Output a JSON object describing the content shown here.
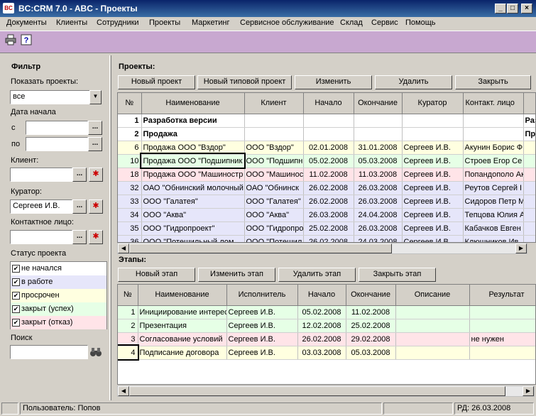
{
  "window": {
    "title": "BC:CRM 7.0 - ABC - Проекты",
    "logo_text": "BC"
  },
  "menu": [
    "Документы",
    "Клиенты",
    "Сотрудники",
    "Проекты",
    "Маркетинг",
    "Сервисное обслуживание",
    "Склад",
    "Сервис",
    "Помощь"
  ],
  "toolbar": {
    "icons": [
      "printer-icon",
      "help-icon"
    ]
  },
  "filter": {
    "title": "Фильтр",
    "show_projects_label": "Показать проекты:",
    "show_projects_value": "все",
    "start_date_label": "Дата начала",
    "from_label": "с",
    "to_label": "по",
    "client_label": "Клиент:",
    "client_value": "",
    "curator_label": "Куратор:",
    "curator_value": "Сергеев И.В.",
    "contact_label": "Контактное лицо:",
    "contact_value": "",
    "status_label": "Статус проекта",
    "statuses": [
      {
        "label": "не начался",
        "color": "#ffffff"
      },
      {
        "label": "в работе",
        "color": "#e6e6fa"
      },
      {
        "label": "просрочен",
        "color": "#ffffe0"
      },
      {
        "label": "закрыт (успех)",
        "color": "#e6ffe6"
      },
      {
        "label": "закрыт (отказ)",
        "color": "#ffe4e8"
      }
    ],
    "search_label": "Поиск",
    "search_value": "",
    "dots": "...",
    "dropdown_arrow": "▼"
  },
  "projects": {
    "title": "Проекты:",
    "buttons": [
      "Новый проект",
      "Новый типовой проект",
      "Изменить",
      "Удалить",
      "Закрыть"
    ],
    "columns": [
      "№",
      "Наименование",
      "Клиент",
      "Начало",
      "Окончание",
      "Куратор",
      "Контакт. лицо"
    ],
    "rows": [
      {
        "n": "1",
        "name": "Разработка версии",
        "client": "",
        "start": "",
        "end": "",
        "curator": "",
        "contact": "",
        "extra": "Раз",
        "bold": true,
        "color": "#ffffff"
      },
      {
        "n": "2",
        "name": "Продажа",
        "client": "",
        "start": "",
        "end": "",
        "curator": "",
        "contact": "",
        "extra": "Пр",
        "bold": true,
        "color": "#ffffff"
      },
      {
        "n": "6",
        "name": "Продажа ООО \"Вздор\"",
        "client": "ООО \"Вздор\"",
        "start": "02.01.2008",
        "end": "31.01.2008",
        "curator": "Сергеев И.В.",
        "contact": "Акунин Борис Ф",
        "extra": "",
        "bold": false,
        "color": "#ffffe0"
      },
      {
        "n": "10",
        "name": "Продажа ООО \"Подшипник",
        "client": "ООО \"Подшипн",
        "start": "05.02.2008",
        "end": "05.03.2008",
        "curator": "Сергеев И.В.",
        "contact": "Строев Егор Се",
        "extra": "",
        "bold": false,
        "color": "#e6ffe6",
        "selected": true
      },
      {
        "n": "18",
        "name": "Продажа ООО \"Машиностр",
        "client": "ООО \"Машиност",
        "start": "11.02.2008",
        "end": "11.03.2008",
        "curator": "Сергеев И.В.",
        "contact": "Попандополо Ак",
        "extra": "",
        "bold": false,
        "color": "#ffe4e8"
      },
      {
        "n": "32",
        "name": "ОАО \"Обнинский молочный",
        "client": "ОАО \"Обнинск",
        "start": "26.02.2008",
        "end": "26.03.2008",
        "curator": "Сергеев И.В.",
        "contact": "Реутов Сергей I",
        "extra": "",
        "bold": false,
        "color": "#e6e6fa"
      },
      {
        "n": "33",
        "name": "ООО \"Галатея\"",
        "client": "ООО \"Галатея\"",
        "start": "26.02.2008",
        "end": "26.03.2008",
        "curator": "Сергеев И.В.",
        "contact": "Сидоров Петр М",
        "extra": "",
        "bold": false,
        "color": "#e6e6fa"
      },
      {
        "n": "34",
        "name": "ООО \"Аква\"",
        "client": "ООО \"Аква\"",
        "start": "26.03.2008",
        "end": "24.04.2008",
        "curator": "Сергеев И.В.",
        "contact": "Тепцова Юлия А",
        "extra": "",
        "bold": false,
        "color": "#e6e6fa"
      },
      {
        "n": "35",
        "name": "ООО \"Гидропроект\"",
        "client": "ООО \"Гидропро",
        "start": "25.02.2008",
        "end": "26.03.2008",
        "curator": "Сергеев И.В.",
        "contact": "Кабачков Евген",
        "extra": "",
        "bold": false,
        "color": "#e6e6fa"
      },
      {
        "n": "36",
        "name": "ООО \"Потешильный лом",
        "client": "ООО \"Потешил",
        "start": "26.02.2008",
        "end": "24.03.2008",
        "curator": "Сергеев И.В.",
        "contact": "Клюшников Ив",
        "extra": "",
        "bold": false,
        "color": "#e6e6fa"
      }
    ]
  },
  "stages": {
    "title": "Этапы:",
    "buttons": [
      "Новый этап",
      "Изменить этап",
      "Удалить этап",
      "Закрыть этап"
    ],
    "columns": [
      "№",
      "Наименование",
      "Исполнитель",
      "Начало",
      "Окончание",
      "Описание",
      "Результат"
    ],
    "rows": [
      {
        "n": "1",
        "name": "Инициирование интерес",
        "exec": "Сергеев И.В.",
        "start": "05.02.2008",
        "end": "11.02.2008",
        "desc": "",
        "result": "",
        "color": "#e6ffe6"
      },
      {
        "n": "2",
        "name": "Презентация",
        "exec": "Сергеев И.В.",
        "start": "12.02.2008",
        "end": "25.02.2008",
        "desc": "",
        "result": "",
        "color": "#e6ffe6"
      },
      {
        "n": "3",
        "name": "Согласование условий",
        "exec": "Сергеев И.В.",
        "start": "26.02.2008",
        "end": "29.02.2008",
        "desc": "",
        "result": "не нужен",
        "color": "#ffe4e8"
      },
      {
        "n": "4",
        "name": "Подписание договора",
        "exec": "Сергеев И.В.",
        "start": "03.03.2008",
        "end": "05.03.2008",
        "desc": "",
        "result": "",
        "color": "#ffffe0",
        "selected": true
      }
    ]
  },
  "statusbar": {
    "user": "Пользователь: Попов",
    "date": "РД: 26.03.2008"
  },
  "scroll_arrows": {
    "left": "◀",
    "right": "▶"
  }
}
